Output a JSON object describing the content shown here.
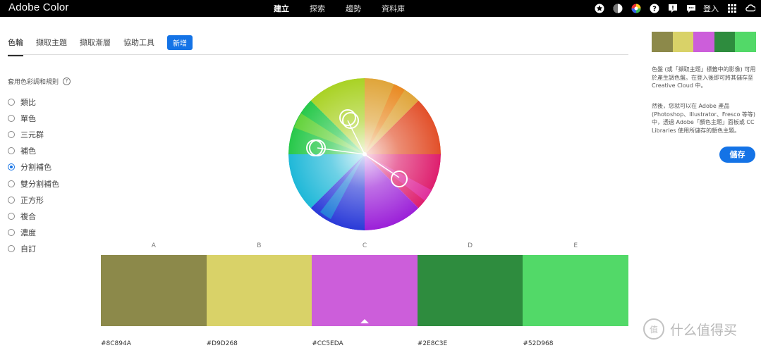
{
  "app": {
    "logo": "Adobe Color"
  },
  "topnav": {
    "items": [
      "建立",
      "探索",
      "趨勢",
      "資料庫"
    ],
    "active": 0
  },
  "topbar": {
    "login": "登入",
    "icons": [
      "star-icon",
      "moon-icon",
      "color-wheel-icon",
      "help-icon",
      "comment-icon",
      "chat-icon",
      "apps-grid-icon",
      "creative-cloud-icon"
    ]
  },
  "tabs": {
    "items": [
      "色輪",
      "擷取主題",
      "擷取漸層",
      "協助工具"
    ],
    "new_button": "新增",
    "active": 0
  },
  "rules": {
    "title": "套用色彩調和規則",
    "help": "?",
    "items": [
      "類比",
      "單色",
      "三元群",
      "補色",
      "分割補色",
      "雙分割補色",
      "正方形",
      "複合",
      "濃度",
      "自訂"
    ],
    "selected": 4
  },
  "swatches": [
    {
      "label": "A",
      "hex": "#8C894A"
    },
    {
      "label": "B",
      "hex": "#D9D268"
    },
    {
      "label": "C",
      "hex": "#CC5EDA"
    },
    {
      "label": "D",
      "hex": "#2E8C3E"
    },
    {
      "label": "E",
      "hex": "#52D968"
    }
  ],
  "selected_swatch": 2,
  "side": {
    "text1": "色盤 (或「擷取主題」標籤中的影像) 可用於產生調色盤。在登入後即可將其儲存至 Creative Cloud 中。",
    "text2": "然後，您就可以在 Adobe 產品 (Photoshop、Illustrator、Fresco 等等) 中，透過 Adobe「顏色主題」面板或 CC Libraries 使用所儲存的顏色主題。",
    "save": "儲存"
  },
  "watermark": {
    "badge": "值",
    "text": "什么值得买"
  }
}
